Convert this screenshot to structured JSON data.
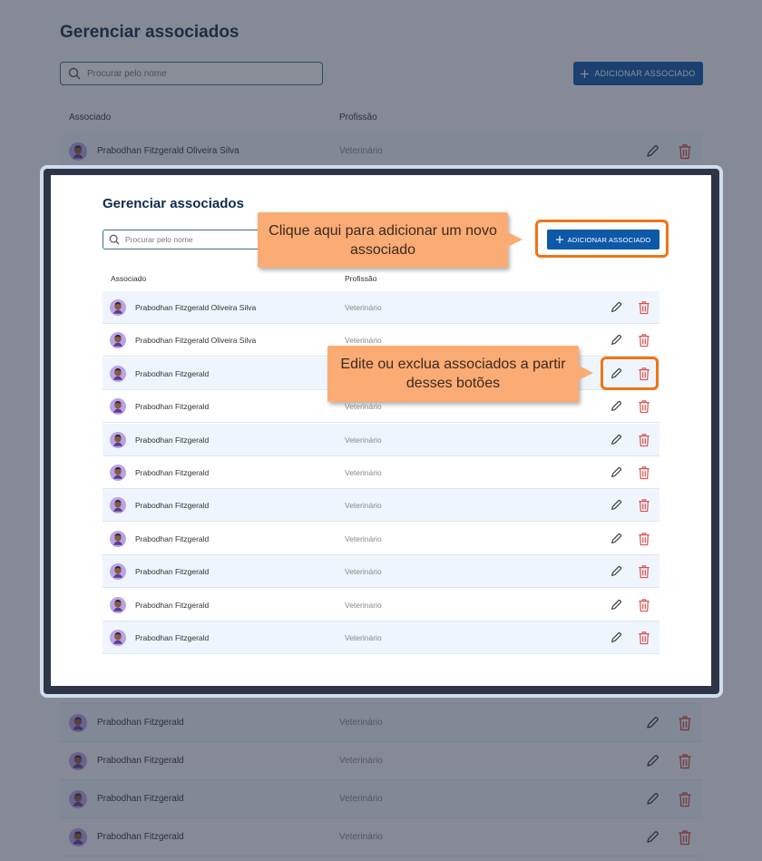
{
  "page": {
    "title": "Gerenciar associados",
    "search_placeholder": "Procurar pelo nome",
    "add_button_label": "ADICIONAR ASSOCIADO",
    "columns": {
      "associate": "Associado",
      "profession": "Profissão"
    }
  },
  "background_rows": [
    {
      "name": "Prabodhan Fitzgerald Oliveira Silva",
      "profession": "Veterinário"
    },
    {
      "name": "Prabodhan Fitzgerald",
      "profession": "Veterinário"
    },
    {
      "name": "Prabodhan Fitzgerald",
      "profession": "Veterinário"
    },
    {
      "name": "Prabodhan Fitzgerald",
      "profession": "Veterinário"
    },
    {
      "name": "Prabodhan Fitzgerald",
      "profession": "Veterinário"
    },
    {
      "name": "Prabodhan Fitzgerald",
      "profession": "Veterinário"
    }
  ],
  "modal_rows": [
    {
      "name": "Prabodhan Fitzgerald Oliveira Silva",
      "profession": "Veterinário"
    },
    {
      "name": "Prabodhan Fitzgerald Oliveira Silva",
      "profession": "Veterinário"
    },
    {
      "name": "Prabodhan Fitzgerald",
      "profession": "Veterinário"
    },
    {
      "name": "Prabodhan Fitzgerald",
      "profession": "Veterinário"
    },
    {
      "name": "Prabodhan Fitzgerald",
      "profession": "Veterinário"
    },
    {
      "name": "Prabodhan Fitzgerald",
      "profession": "Veterinário"
    },
    {
      "name": "Prabodhan Fitzgerald",
      "profession": "Veterinário"
    },
    {
      "name": "Prabodhan Fitzgerald",
      "profession": "Veterinário"
    },
    {
      "name": "Prabodhan Fitzgerald",
      "profession": "Veterinário"
    },
    {
      "name": "Prabodhan Fitzgerald",
      "profession": "Veterinário"
    },
    {
      "name": "Prabodhan Fitzgerald",
      "profession": "Veterinário"
    }
  ],
  "callouts": {
    "add": "Clique aqui para adicionar um novo associado",
    "actions": "Edite ou exclua associados a partir desses botões"
  },
  "icons": {
    "search": "search-icon",
    "plus": "plus-icon",
    "edit": "pencil-icon",
    "delete": "trash-icon",
    "avatar": "avatar-icon"
  },
  "colors": {
    "primary": "#0e58a8",
    "title": "#0f2a4e",
    "highlight": "#f07416",
    "callout": "#fbab74",
    "delete": "#d9534f"
  }
}
